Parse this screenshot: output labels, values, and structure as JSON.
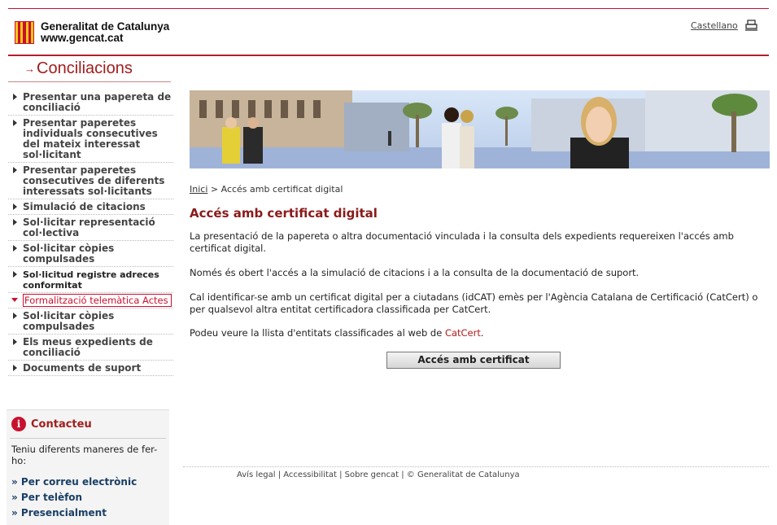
{
  "header": {
    "brand_line1": "Generalitat de Catalunya",
    "brand_line2": "www.gencat.cat",
    "language_link": "Castellano",
    "print_icon": "printer-icon",
    "accent_color": "#c8102e"
  },
  "section_title": "Conciliacions",
  "sidebar": {
    "items": [
      {
        "label": "Presentar una papereta de conciliació"
      },
      {
        "label": "Presentar paperetes individuals consecutives del mateix interessat sol·licitant"
      },
      {
        "label": "Presentar paperetes consecutives de diferents interessats sol·licitants"
      },
      {
        "label": "Simulació de citacions"
      },
      {
        "label": "Sol·licitar representació col·lectiva"
      },
      {
        "label": "Sol·licitar còpies compulsades"
      },
      {
        "label": "Sol·licitud registre adreces conformitat"
      },
      {
        "label": "Formalització telemàtica Actes"
      },
      {
        "label": "Sol·licitar còpies compulsades"
      },
      {
        "label": "Els meus expedients de conciliació"
      },
      {
        "label": "Documents de suport"
      }
    ]
  },
  "contact": {
    "title": "Contacteu",
    "icon": "info-icon",
    "text": "Teniu diferents maneres de fer-ho:",
    "links": [
      "» Per correu electrònic",
      "» Per telèfon",
      "» Presencialment"
    ]
  },
  "breadcrumb": {
    "home": "Inici",
    "separator": ">",
    "current": "Accés amb certificat digital"
  },
  "main": {
    "heading": "Accés amb certificat digital",
    "p1": "La presentació de la papereta o altra documentació vinculada i la consulta dels expedients requereixen l'accés amb certificat digital.",
    "p2": "Només és obert l'accés a la simulació de citacions i a la consulta de la documentació de suport.",
    "p3": "Cal identificar-se amb un certificat digital per a ciutadans (idCAT) emès per l'Agència Catalana de Certificació (CatCert) o per qualsevol altra entitat certificadora classificada per CatCert.",
    "p4_prefix": "Podeu veure la llista d'entitats classificades al web de",
    "p4_link": "CatCert",
    "p4_suffix": ".",
    "button": "Accés amb certificat"
  },
  "footer": {
    "text": "Avís legal | Accessibilitat | Sobre gencat | © Generalitat de Catalunya"
  }
}
